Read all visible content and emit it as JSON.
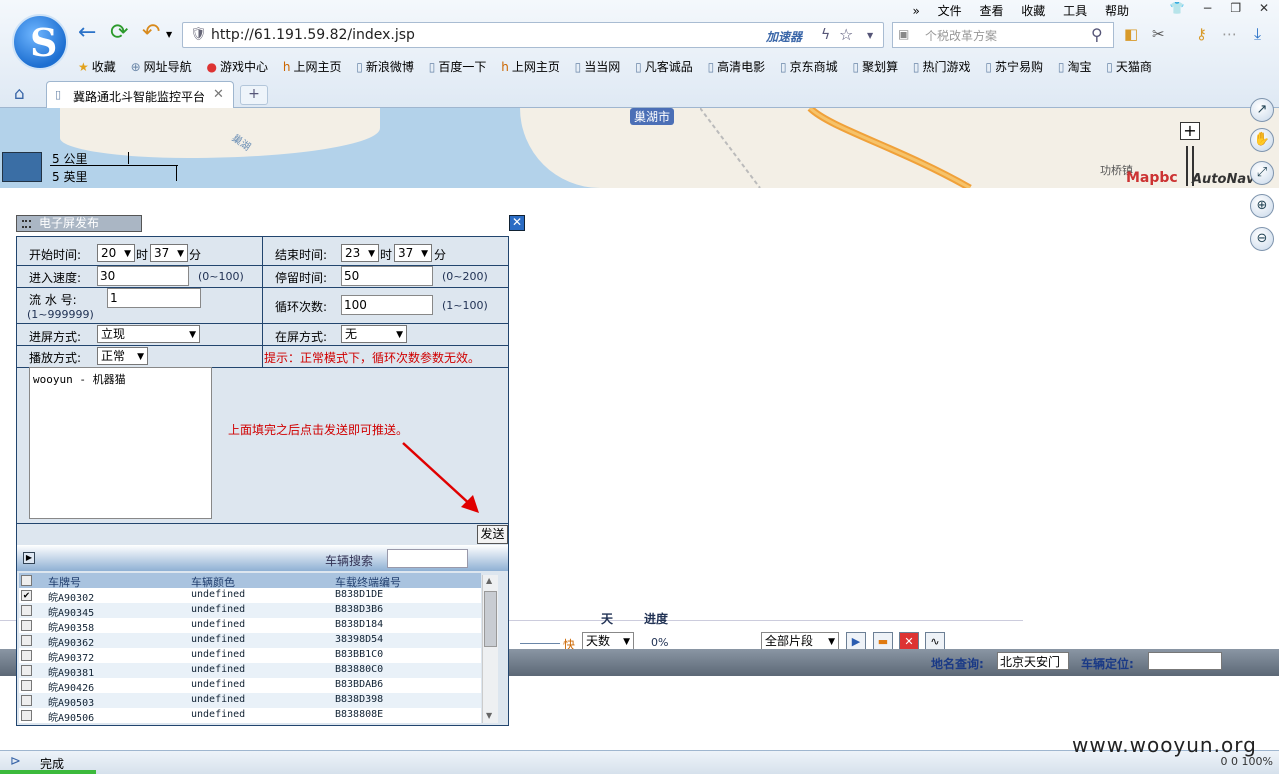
{
  "browser": {
    "menu": [
      "文件",
      "查看",
      "收藏",
      "工具",
      "帮助"
    ],
    "url": "http://61.191.59.82/index.jsp",
    "accelerator": "加速器",
    "search_placeholder": "个税改革方案",
    "bookmarks": [
      "收藏",
      "网址导航",
      "游戏中心",
      "上网主页",
      "新浪微博",
      "百度一下",
      "上网主页",
      "当当网",
      "凡客诚品",
      "高清电影",
      "京东商城",
      "聚划算",
      "热门游戏",
      "苏宁易购",
      "淘宝",
      "天猫商"
    ],
    "tab_title": "冀路通北斗智能监控平台",
    "tab_new": "+",
    "status_text": "完成",
    "status_right": "0   0   100%",
    "watermark": "www.wooyun.org"
  },
  "map": {
    "city": "巢湖市",
    "lake": "巢湖",
    "place": "功桥镇",
    "scale_km": "5 公里",
    "scale_mi": "5 英里",
    "logo_a": "Mapbc",
    "logo_b": "AutoNavi"
  },
  "dialog": {
    "title": "电子屏发布",
    "start_label": "开始时间:",
    "start_hour": "20",
    "start_min": "37",
    "hour_unit": "时",
    "min_unit": "分",
    "end_label": "结束时间:",
    "end_hour": "23",
    "end_min": "37",
    "speed_label": "进入速度:",
    "speed_value": "30",
    "speed_hint": "(0~100)",
    "stay_label": "停留时间:",
    "stay_value": "50",
    "stay_hint": "(0~200)",
    "serial_label": "流  水  号:",
    "serial_value": "1",
    "serial_hint": "(1~999999)",
    "loop_label": "循环次数:",
    "loop_value": "100",
    "loop_hint": "(1~100)",
    "enter_mode_label": "进屏方式:",
    "enter_mode_value": "立现",
    "onscreen_label": "在屏方式:",
    "onscreen_value": "无",
    "play_mode_label": "播放方式:",
    "play_mode_value": "正常",
    "tip": "提示：正常模式下，循环次数参数无效。",
    "message": "wooyun - 机器猫",
    "instruction": "上面填完之后点击发送即可推送。",
    "send_label": "发送",
    "vehicle_search_label": "车辆搜索",
    "columns": [
      "车牌号",
      "车辆颜色",
      "车载终端编号"
    ],
    "vehicles": [
      {
        "plate": "皖A90302",
        "color": "undefined",
        "terminal": "B838D1DE",
        "checked": true
      },
      {
        "plate": "皖A90345",
        "color": "undefined",
        "terminal": "B838D3B6",
        "checked": false
      },
      {
        "plate": "皖A90358",
        "color": "undefined",
        "terminal": "B838D184",
        "checked": false
      },
      {
        "plate": "皖A90362",
        "color": "undefined",
        "terminal": "38398D54",
        "checked": false
      },
      {
        "plate": "皖A90372",
        "color": "undefined",
        "terminal": "B83BB1C0",
        "checked": false
      },
      {
        "plate": "皖A90381",
        "color": "undefined",
        "terminal": "B83880C0",
        "checked": false
      },
      {
        "plate": "皖A90426",
        "color": "undefined",
        "terminal": "B83BDAB6",
        "checked": false
      },
      {
        "plate": "皖A90503",
        "color": "undefined",
        "terminal": "B838D398",
        "checked": false
      },
      {
        "plate": "皖A90506",
        "color": "undefined",
        "terminal": "B838808E",
        "checked": false
      }
    ]
  },
  "playback": {
    "col_day": "天",
    "col_progress": "进度",
    "speed": "快",
    "days": "天数",
    "progress": "0%",
    "segment": "全部片段",
    "place_label": "地名查询:",
    "place_value": "北京天安门",
    "vehicle_loc_label": "车辆定位:"
  },
  "colors": {
    "dialog_border": "#22456e",
    "dialog_bg": "#dde6ef",
    "tip_red": "#d00000",
    "close_blue": "#2b6cc4"
  }
}
